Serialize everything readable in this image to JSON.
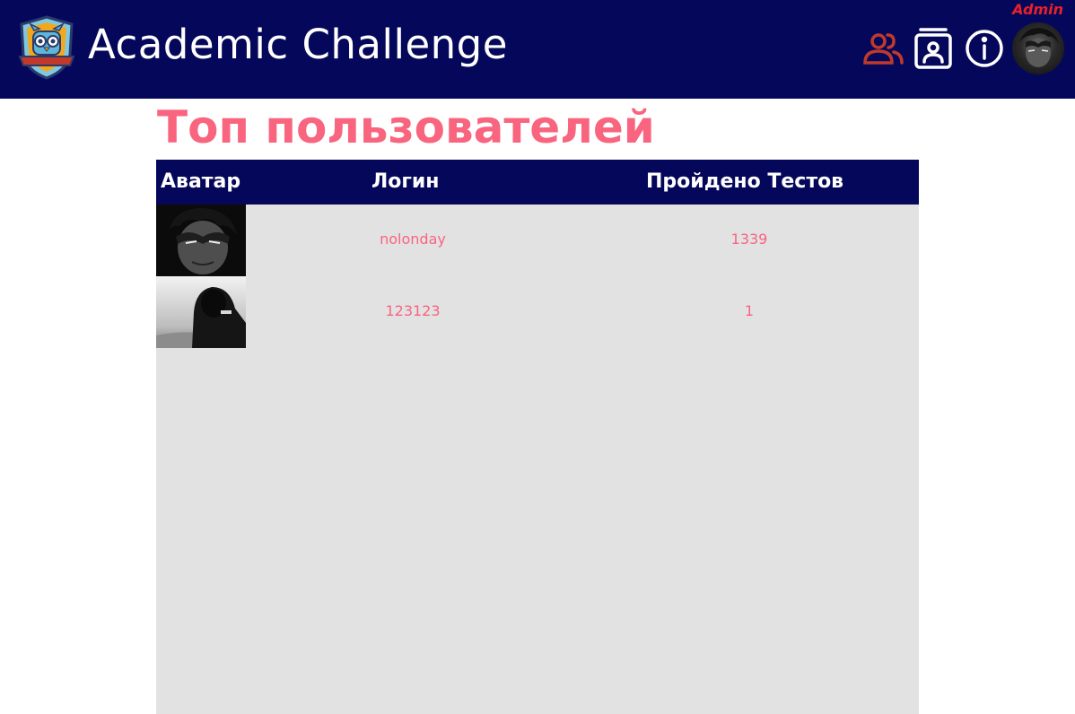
{
  "header": {
    "title": "Academic Challenge",
    "role": "Admin",
    "icons": {
      "logo": "owl-shield-logo",
      "users": "users-icon",
      "profile": "profile-card-icon",
      "info": "info-icon",
      "avatar": "user-avatar"
    }
  },
  "page": {
    "title": "Топ пользователей"
  },
  "table": {
    "columns": {
      "avatar": "Аватар",
      "login": "Логин",
      "tests": "Пройдено Тестов"
    },
    "rows": [
      {
        "login": "nolonday",
        "tests": "1339"
      },
      {
        "login": "123123",
        "tests": "1"
      }
    ]
  },
  "colors": {
    "header_bg": "#05085a",
    "accent": "#f9647f",
    "role": "#e8202a",
    "users_icon": "#c0392b",
    "table_bg": "#e2e2e2"
  }
}
